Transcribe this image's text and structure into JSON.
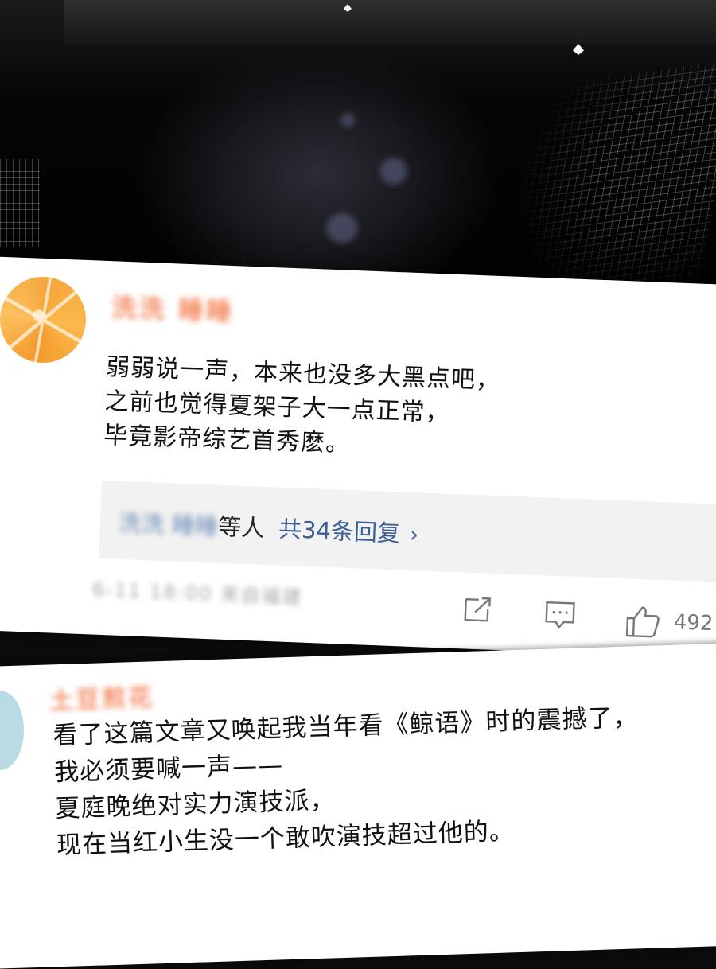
{
  "comment1": {
    "username": "洗洗 睡睡",
    "text": "弱弱说一声，本来也没多大黑点吧，\n之前也觉得夏架子大一点正常，\n毕竟影帝综艺首秀麽。",
    "reply_names": "洗洗 睡睡",
    "reply_suffix": "等人",
    "reply_count": "共34条回复",
    "meta": "6-11 18:00 来自福建",
    "likes": "492"
  },
  "comment2": {
    "username": "土豆煎花",
    "text": "看了这篇文章又唤起我当年看《鲸语》时的震撼了，\n我必须要喊一声——\n夏庭晚绝对实力演技派，\n现在当红小生没一个敢吹演技超过他的。"
  },
  "icons": [
    "share-icon",
    "comment-icon",
    "like-icon",
    "chevron-right-icon"
  ],
  "colors": {
    "username": "#f48c63",
    "link": "#3d5f94",
    "reply_bg": "#f2f2f2"
  }
}
